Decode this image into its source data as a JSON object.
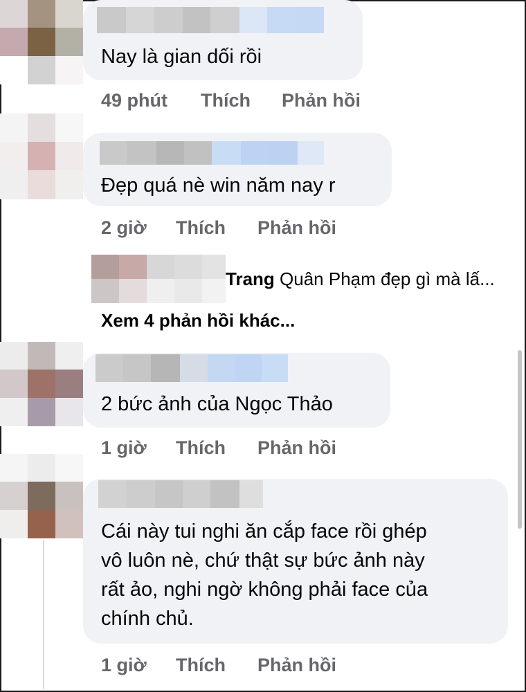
{
  "comments": [
    {
      "text_lines": [
        "Nay là gian dối rồi"
      ],
      "time": "49 phút",
      "like": "Thích",
      "reply": "Phản hồi"
    },
    {
      "text_lines": [
        "Đẹp quá nè win năm nay r"
      ],
      "time": "2 giờ",
      "like": "Thích",
      "reply": "Phản hồi",
      "reply_preview": {
        "name": "Trang",
        "text": "Quân Phạm đẹp gì mà lấ..."
      },
      "more_replies": "Xem 4 phản hồi khác..."
    },
    {
      "text_lines": [
        "2 bức ảnh của Ngọc Thảo"
      ],
      "time": "1 giờ",
      "like": "Thích",
      "reply": "Phản hồi"
    },
    {
      "text_lines": [
        "Cái này tui nghi ăn cắp face rồi ghép",
        "vô luôn nè, chứ thật sự bức ảnh này",
        "rất ảo, nghi ngờ không phải face của",
        "chính chủ."
      ],
      "time": "1 giờ",
      "like": "Thích",
      "reply": "Phản hồi"
    }
  ],
  "colors": {
    "bubble": "#f0f2f5",
    "meta": "#65676b",
    "text": "#050505"
  }
}
